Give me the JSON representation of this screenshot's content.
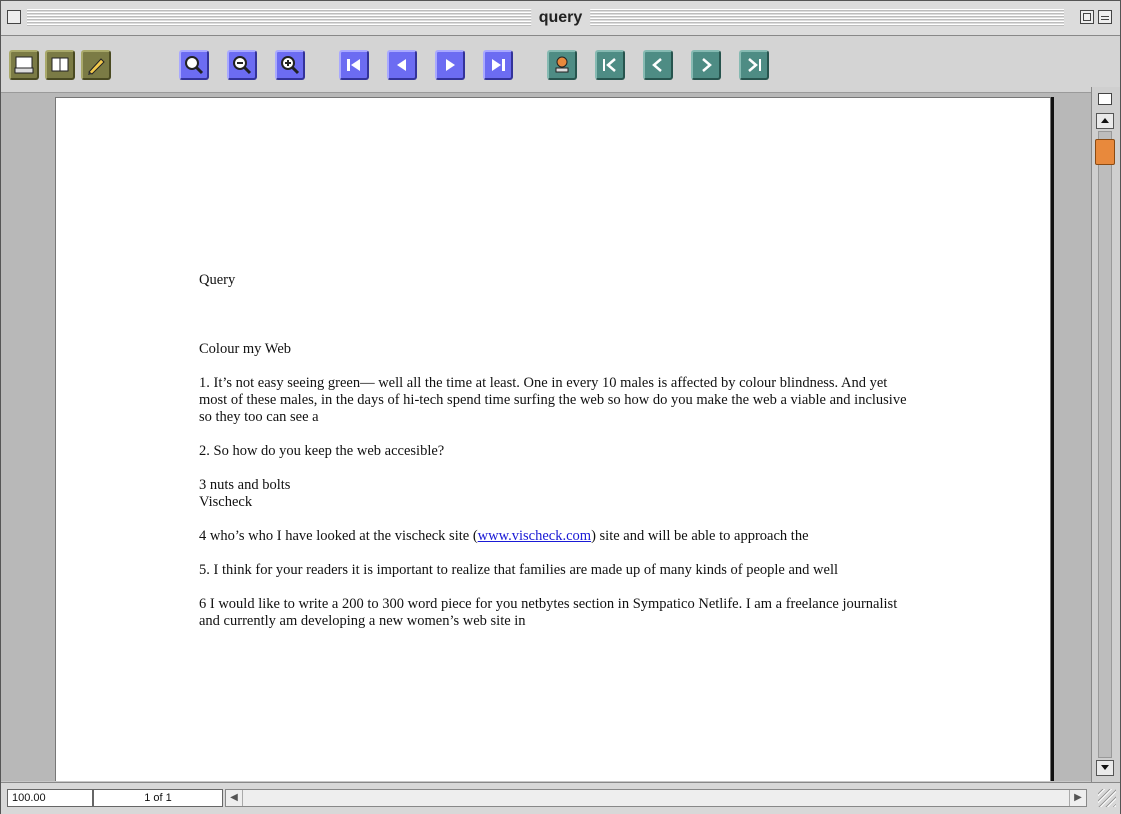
{
  "window": {
    "title": "query"
  },
  "toolbar": {
    "buttons": [
      {
        "name": "print-icon",
        "color": "olive"
      },
      {
        "name": "open-book-icon",
        "color": "olive"
      },
      {
        "name": "pencil-icon",
        "color": "olive"
      },
      {
        "name": "magnifier-icon",
        "color": "blue"
      },
      {
        "name": "zoom-out-icon",
        "color": "blue"
      },
      {
        "name": "zoom-in-icon",
        "color": "blue"
      },
      {
        "name": "first-page-icon",
        "color": "blue"
      },
      {
        "name": "previous-page-icon",
        "color": "blue"
      },
      {
        "name": "next-page-icon",
        "color": "blue"
      },
      {
        "name": "last-page-icon",
        "color": "blue"
      },
      {
        "name": "stamp-icon",
        "color": "teal"
      },
      {
        "name": "first-icon",
        "color": "teal"
      },
      {
        "name": "back-icon",
        "color": "teal"
      },
      {
        "name": "forward-icon",
        "color": "teal"
      },
      {
        "name": "last-icon",
        "color": "teal"
      }
    ]
  },
  "document": {
    "title": "Query",
    "heading": "Colour my Web",
    "p1": "1. It’s not easy seeing green— well all the time at least. One in every 10 males is affected by colour blindness. And yet most of these males, in the days of hi-tech spend time surfing the web so how do you make the web a viable and inclusive so they too can see a",
    "p2": "2. So how do you keep the web accesible?",
    "p3_line1": "3 nuts and bolts",
    "p3_line2": "Vischeck",
    "p4_before": " 4 who’s who I have looked at the vischeck site (",
    "p4_link": "www.vischeck.com",
    "p4_after": ") site and will be able to approach the",
    "p5": "5. I think for your readers it is important to realize that families are made up of many kinds of people and well",
    "p6": "6 I would like to write a 200 to 300 word piece for you netbytes section in Sympatico Netlife. I am a freelance journalist and currently am developing a new women’s web site in"
  },
  "status": {
    "zoom": "100.00",
    "page": "1 of 1"
  },
  "colors": {
    "olive": "#7b7b45",
    "blue": "#6c6cf2",
    "teal": "#4e8c84",
    "scroll_thumb": "#e8893c",
    "link": "#1a1ad6"
  }
}
